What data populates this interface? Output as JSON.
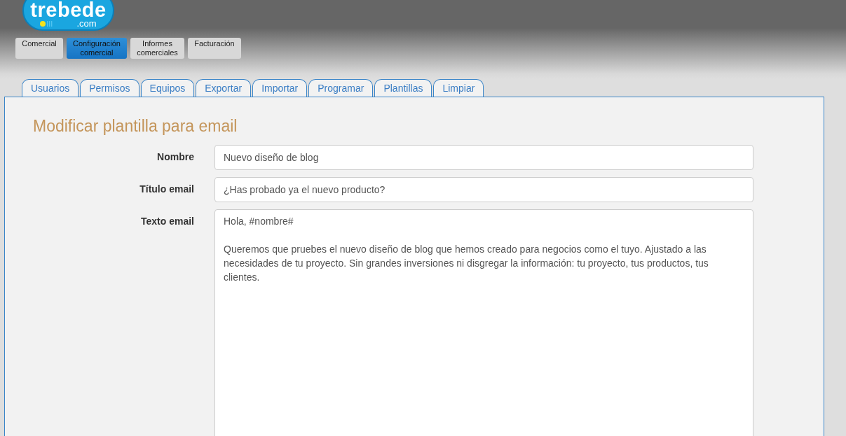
{
  "logo": {
    "name": "trebede",
    "domain": ".com"
  },
  "main_nav": [
    {
      "label": "Comercial",
      "selected": false
    },
    {
      "label": "Configuración comercial",
      "selected": true
    },
    {
      "label": "Informes comerciales",
      "selected": false
    },
    {
      "label": "Facturación",
      "selected": false
    }
  ],
  "tabs": [
    "Usuarios",
    "Permisos",
    "Equipos",
    "Exportar",
    "Importar",
    "Programar",
    "Plantillas",
    "Limpiar"
  ],
  "form": {
    "title": "Modificar plantilla para email",
    "fields": [
      {
        "kind": "input",
        "label": "Nombre",
        "value": "Nuevo diseño de blog"
      },
      {
        "kind": "input",
        "label": "Título email",
        "value": "¿Has probado ya el nuevo producto?"
      },
      {
        "kind": "textarea",
        "label": "Texto email",
        "value": "Hola, #nombre#\n\nQueremos que pruebes el nuevo diseño de blog que hemos creado para negocios como el tuyo. Ajustado a las necesidades de tu proyecto. Sin grandes inversiones ni disgregar la información: tu proyecto, tus productos, tus clientes."
      }
    ]
  }
}
